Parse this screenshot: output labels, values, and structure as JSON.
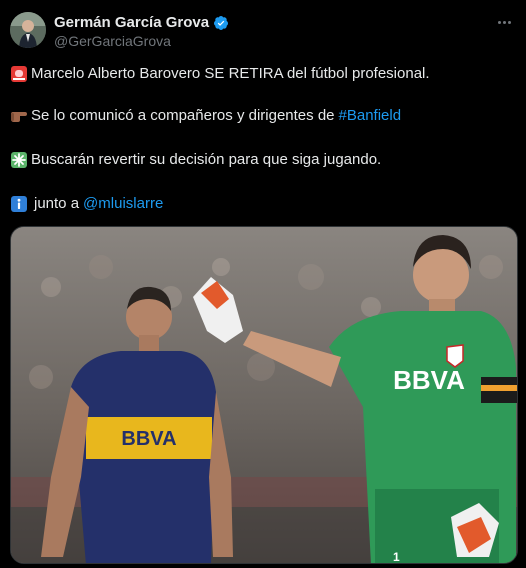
{
  "author": {
    "display_name": "Germán García Grova",
    "handle": "@GerGarciaGrova"
  },
  "icons": {
    "verified": "verified-badge-icon",
    "more": "more-options-icon",
    "line1": "rotating-light-emoji",
    "line2": "pointing-right-hand-emoji",
    "line3": "sparkle-emoji",
    "line4": "information-emoji"
  },
  "tweet": {
    "line1_text": "Marcelo Alberto Barovero SE RETIRA del fútbol profesional.",
    "line2_text": "Se lo comunicó a compañeros y dirigentes de ",
    "line2_link": "#Banfield",
    "line3_text": "Buscarán revertir su decisión para que siga jugando.",
    "line4_text": "junto a ",
    "line4_link": "@mluislarre"
  },
  "media": {
    "left_jersey_text": "BBVA",
    "right_jersey_text": "BBVA",
    "right_jersey_number": "1"
  },
  "colors": {
    "background": "#000000",
    "text": "#e7e9ea",
    "secondary_text": "#71767b",
    "link": "#1d9bf0",
    "verified": "#1d9bf0"
  }
}
